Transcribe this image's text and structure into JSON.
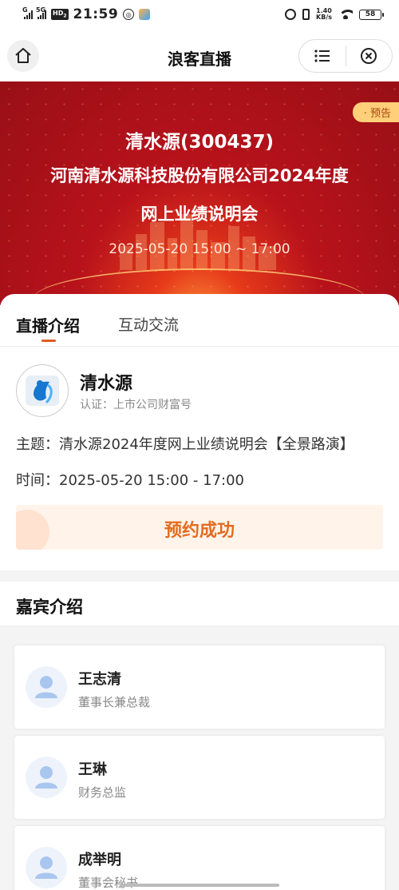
{
  "status_bar": {
    "signal_1": "G",
    "signal_2": "5G",
    "hd_badge": "HD",
    "hd_sub": "2",
    "time": "21:59",
    "net_speed_value": "1.40",
    "net_speed_unit": "KB/s",
    "battery": "58"
  },
  "navbar": {
    "title": "浪客直播",
    "home_icon": "home-icon",
    "menu_icon": "menu-icon",
    "close_icon": "close-circle-icon"
  },
  "banner": {
    "line1": "清水源(300437)",
    "line2": "河南清水源科技股份有限公司2024年度",
    "line3": "网上业绩说明会",
    "line4": "2025-05-20 15:00 ~ 17:00",
    "badge": "· 预告",
    "bg_color": "#b8121b",
    "badge_color": "#ffcf7a"
  },
  "tabs": [
    {
      "label": "直播介绍",
      "active": true
    },
    {
      "label": "互动交流",
      "active": false
    }
  ],
  "host": {
    "name": "清水源",
    "certification": "认证：上市公司财富号"
  },
  "details": {
    "topic": "主题：清水源2024年度网上业绩说明会【全景路演】",
    "time": "时间：2025-05-20 15:00 - 17:00"
  },
  "reserve": {
    "label": "预约成功",
    "accent": "#e46b1f"
  },
  "guests_section": {
    "title": "嘉宾介绍",
    "guests": [
      {
        "name": "王志清",
        "role": "董事长兼总裁"
      },
      {
        "name": "王琳",
        "role": "财务总监"
      },
      {
        "name": "成举明",
        "role": "董事会秘书"
      }
    ]
  }
}
